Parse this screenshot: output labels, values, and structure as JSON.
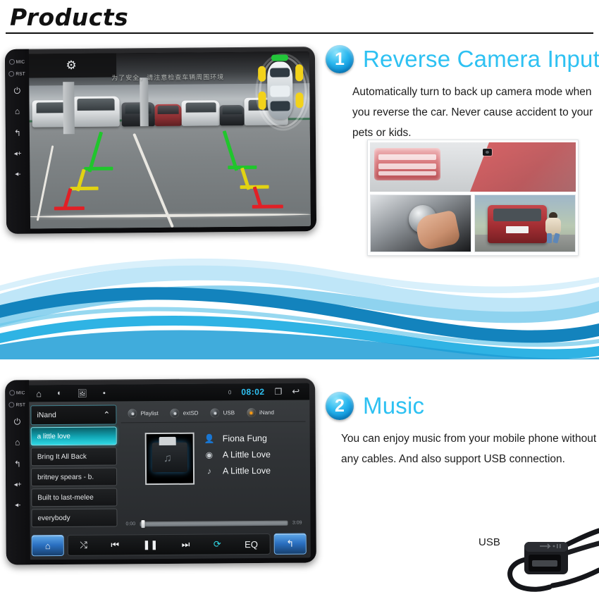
{
  "header": {
    "title": "Products"
  },
  "features": [
    {
      "number": "1",
      "title": "Reverse Camera Input",
      "body": "Automatically turn to back up camera mode when you reverse the car. Never cause accident to your pets or kids."
    },
    {
      "number": "2",
      "title": "Music",
      "body": "You can enjoy music from your mobile phone without any cables. And also support USB connection."
    }
  ],
  "camera_device": {
    "bezel": [
      {
        "label": "MIC",
        "icon": "mic-dot-icon"
      },
      {
        "label": "RST",
        "icon": "reset-dot-icon"
      },
      {
        "label": "⏻",
        "icon": "power-icon"
      },
      {
        "label": "⌂",
        "icon": "home-icon"
      },
      {
        "label": "↶",
        "icon": "back-icon"
      },
      {
        "label": "◂+",
        "icon": "volume-up-icon"
      },
      {
        "label": "◂-",
        "icon": "volume-down-icon"
      }
    ],
    "warning_text": "为了安全，请注意检查车辆周围环境",
    "settings_icon": "gear-icon",
    "guideline_colors": {
      "near": "#e12026",
      "mid": "#e2d312",
      "far": "#20c62c"
    },
    "overlay_arrow_color": "#23c63a",
    "sensor_arc_color": "#f2d21a"
  },
  "collage": {
    "top_caption": "rear-camera-module",
    "bottom_left": "gear-shifter",
    "bottom_right": "suv-child-behind"
  },
  "music_device": {
    "statusbar": {
      "left_icons": [
        "home-icon",
        "brightness-icon",
        "image-icon",
        "dot-icon"
      ],
      "notification_count": "0",
      "clock": "08:02",
      "right_icons": [
        "recents-icon",
        "back-icon"
      ]
    },
    "playlist": {
      "source_label": "iNand",
      "collapse_icon": "chevron-up-icon",
      "items": [
        "a little love",
        "Bring It All Back",
        "britney spears - b.",
        "Built to last-melee",
        "everybody"
      ],
      "active_index": 0
    },
    "sources": [
      {
        "label": "Playlist",
        "active": false
      },
      {
        "label": "extSD",
        "active": false
      },
      {
        "label": "USB",
        "active": false
      },
      {
        "label": "iNand",
        "active": true
      }
    ],
    "now_playing": {
      "artist": "Fiona Fung",
      "album": "A Little Love",
      "track": "A Little Love",
      "artist_icon": "person-icon",
      "album_icon": "disc-icon",
      "track_icon": "note-icon",
      "album_art": "music-folder-icon"
    },
    "seek": {
      "elapsed": "0:00",
      "total": "3:09",
      "progress_percent": 1
    },
    "controls": [
      {
        "name": "home-button",
        "icon": "⌂",
        "style": "blue"
      },
      {
        "name": "shuffle-button",
        "icon": "⤨",
        "style": "dark"
      },
      {
        "name": "previous-button",
        "icon": "⏮",
        "style": "dark"
      },
      {
        "name": "pause-button",
        "icon": "⏸",
        "style": "dark"
      },
      {
        "name": "next-button",
        "icon": "⏭",
        "style": "dark"
      },
      {
        "name": "repeat-button",
        "icon": "↻",
        "style": "dark-cyan"
      },
      {
        "name": "eq-button",
        "icon": "EQ",
        "style": "dark"
      },
      {
        "name": "back-button",
        "icon": "↶",
        "style": "blue"
      }
    ]
  },
  "usb": {
    "label": "USB"
  },
  "colors": {
    "accent": "#2ec1f2",
    "badge": "#0d8fd6",
    "text": "#1c1c1c",
    "wave_dark": "#1383bd",
    "wave_mid": "#3fb7e8",
    "wave_light": "#a9dff5"
  }
}
